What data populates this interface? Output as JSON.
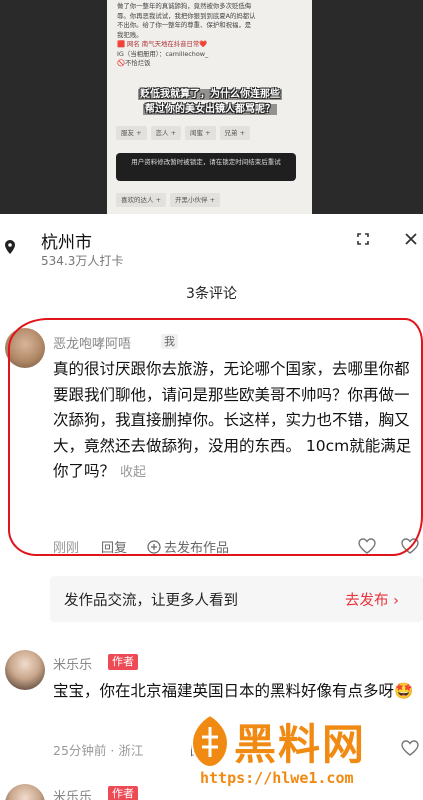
{
  "top_screenshot": {
    "bio_lines": [
      "做了你一整年的真诚舔狗，竟然被你多次贬低侮",
      "辱。你再恶我试试，我把你狠到到底夏A的妈都认",
      "不出你。给了你一整年的尊重、保护和祝福，是",
      "我犯贱。",
      "🟥 网名  南气天地在抖音日常❤️",
      "IG（当相册用）：camillechow_",
      "🚫不恰烂饭"
    ],
    "caption_lines": [
      "贬低我就算了，为什么你连那些",
      "帮过你的美女出镜人都骂呢？"
    ],
    "tags_row1": [
      "服友 +",
      "恋人 +",
      "闺蜜 +",
      "兄弟 +"
    ],
    "tags_row2": [
      "喜欢的达人 +",
      "开黑小伙伴 +"
    ],
    "toast_text": "用户资料修改暂时被锁定，请在锁定时间结束后重试"
  },
  "location": {
    "title": "杭州市",
    "subtitle": "534.3万人打卡"
  },
  "comments_header": "3条评论",
  "comment1": {
    "author": "恶龙咆哮阿唔",
    "badge": "我",
    "text": "真的很讨厌跟你去旅游，无论哪个国家，去哪里你都要跟我们聊他，请问是那些欧美哥不帅吗？你再做一次舔狗，我直接删掉你。长这样，实力也不错，胸又大，竟然还去做舔狗，没用的东西。  10cm就能满足你了吗？",
    "fold_label": "收起",
    "time": "刚刚",
    "reply_label": "回复",
    "post_label": "去发布作品"
  },
  "promo": {
    "text": "发作品交流，让更多人看到",
    "button": "去发布 ›"
  },
  "comment2": {
    "author": "米乐乐",
    "badge": "作者",
    "text": "宝宝，你在北京福建英国日本的黑料好像有点多呀🤩",
    "meta": "25分钟前 · 浙江",
    "reply_label": "回复"
  },
  "comment3": {
    "author": "米乐乐",
    "badge": "作者"
  },
  "watermark": {
    "title": "黑料网",
    "url": "https://hlwe1.com"
  },
  "colors": {
    "accent_red": "#e8333a",
    "annotation_red": "#e0141b",
    "watermark_orange": "#f08a12"
  }
}
